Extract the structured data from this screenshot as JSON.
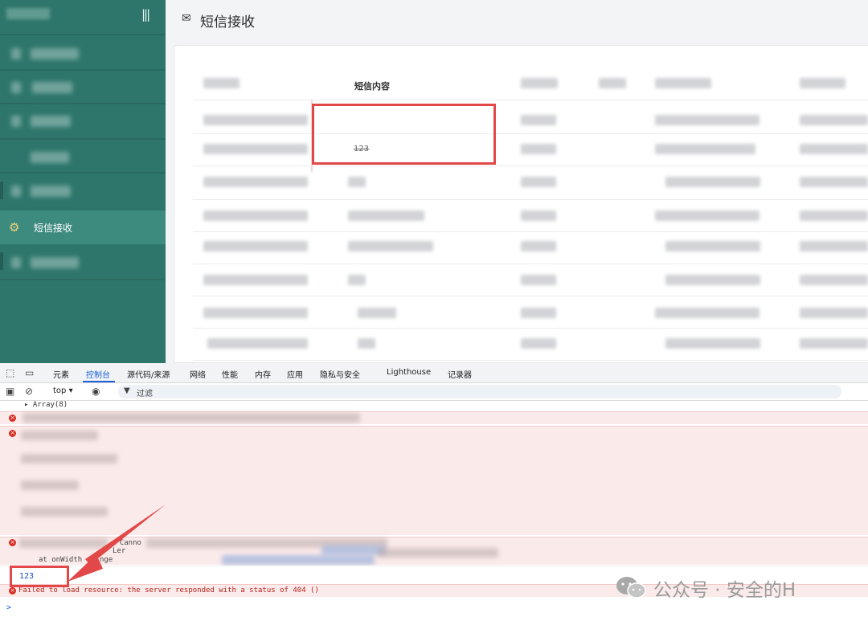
{
  "header": {
    "title": "短信接收"
  },
  "sidebar": {
    "active_item": "短信接收"
  },
  "table": {
    "content_header": "短信内容",
    "highlighted_cell": "123"
  },
  "devtools": {
    "tabs": [
      "元素",
      "控制台",
      "源代码/来源",
      "网络",
      "性能",
      "内存",
      "应用",
      "隐私与安全",
      "Lighthouse",
      "记录器"
    ],
    "active_tab": "控制台",
    "context": "top",
    "filter_placeholder": "过滤"
  },
  "console": {
    "array_line": "▸ Array(8)",
    "error_fragment_1": ": Canno",
    "error_fragment_2": "at onWidth",
    "error_fragment_3": "nge",
    "error_fragment_4": "Ler",
    "log_value": "123",
    "failed_message": "Failed to load resource: the server responded with a status of 404 ()",
    "prompt": ">"
  },
  "watermark": {
    "text": "公众号 · 安全的H"
  },
  "colors": {
    "sidebar": "#2e766b",
    "sidebar_active": "#3d8b7f",
    "highlight": "#e24848",
    "devtools_active": "#1a62d6"
  }
}
